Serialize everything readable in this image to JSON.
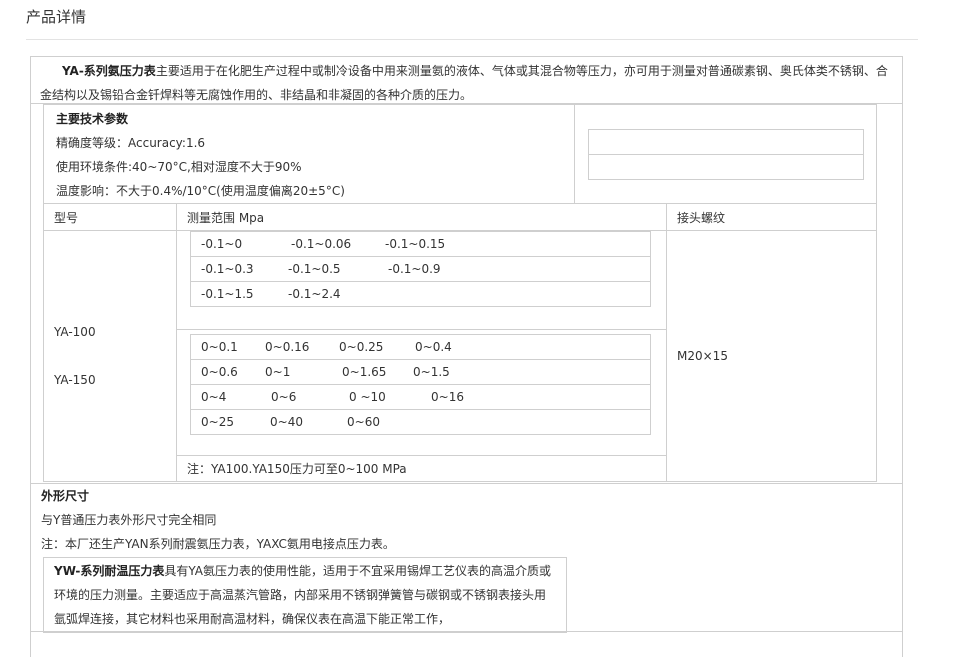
{
  "page": {
    "title": "产品详情"
  },
  "intro": {
    "product_name": "YA-系列氨压力表",
    "description": "主要适用于在化肥生产过程中或制冷设备中用来测量氨的液体、气体或其混合物等压力，亦可用于测量对普通碳素钢、奥氏体类不锈钢、合金结构以及锡铅合金钎焊料等无腐蚀作用的、非结晶和非凝固的各种介质的压力。"
  },
  "specs": {
    "title": "主要技术参数",
    "accuracy": "精确度等级：Accuracy:1.6",
    "environment": "使用环境条件:40~70°C,相对湿度不大于90%",
    "temperature": "温度影响：不大于0.4%/10°C(使用温度偏离20±5°C)"
  },
  "table": {
    "col_model": "型号",
    "col_range": "测量范围 Mpa",
    "col_thread": "接头螺纹",
    "models": [
      "YA-100",
      "YA-150"
    ],
    "negative_ranges": [
      [
        "-0.1~0",
        "-0.1~0.06",
        "-0.1~0.15"
      ],
      [
        "-0.1~0.3",
        "-0.1~0.5",
        "-0.1~0.9"
      ],
      [
        "-0.1~1.5",
        "-0.1~2.4"
      ]
    ],
    "positive_ranges": [
      [
        "0~0.1",
        "0~0.16",
        "0~0.25",
        "0~0.4"
      ],
      [
        "0~0.6",
        "0~1",
        "0~1.65",
        "0~1.5"
      ],
      [
        "0~4",
        "0~6",
        "0 ~10",
        "0~16"
      ],
      [
        "0~25",
        "0~40",
        "0~60"
      ]
    ],
    "thread": "M20×15",
    "note": "注：YA100.YA150压力可至0~100 MPa"
  },
  "dimensions": {
    "title": "外形尺寸",
    "text": "与Y普通压力表外形尺寸完全相同",
    "note": "注：本厂还生产YAN系列耐震氨压力表，YAXC氨用电接点压力表。"
  },
  "yw": {
    "product_name": "YW-系列耐温压力表",
    "line1": "具有YA氨压力表的使用性能，适用于不宜采用锡焊工艺仪表的高温介质或",
    "line2": "环境的压力测量。主要适应于高温蒸汽管路，内部采用不锈钢弹簧管与碳钢或不锈钢表接头用",
    "line3": "氩弧焊连接，其它材料也采用耐高温材料，确保仪表在高温下能正常工作，"
  }
}
